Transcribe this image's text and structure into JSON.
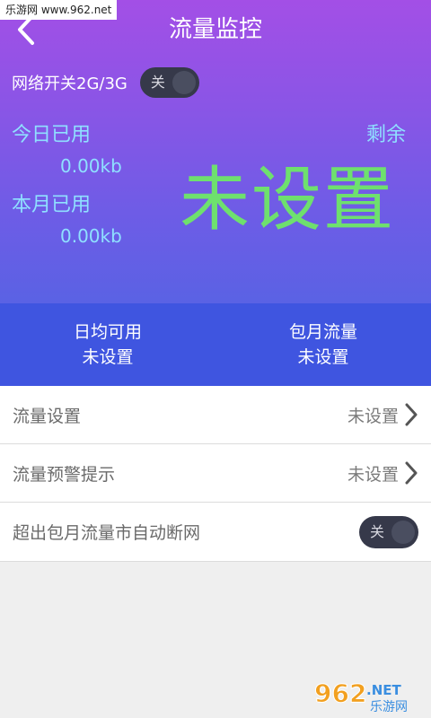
{
  "watermark_top": "乐游网 www.962.net",
  "header": {
    "title": "流量监控"
  },
  "network": {
    "label": "网络开关2G/3G",
    "toggle_text": "关"
  },
  "stats": {
    "today_label": "今日已用",
    "today_value": "0.00kb",
    "month_label": "本月已用",
    "month_value": "0.00kb",
    "remain_label": "剩余",
    "remain_value": "未设置"
  },
  "summary": {
    "daily_label": "日均可用",
    "daily_value": "未设置",
    "package_label": "包月流量",
    "package_value": "未设置"
  },
  "settings": [
    {
      "label": "流量设置",
      "value": "未设置"
    },
    {
      "label": "流量预警提示",
      "value": "未设置"
    }
  ],
  "auto_cut": {
    "label": "超出包月流量市自动断网",
    "toggle_text": "关"
  },
  "watermark_bottom": {
    "main": "962",
    "suffix": ".NET",
    "sub": "乐游网"
  },
  "colors": {
    "accent_green": "#6ee06e",
    "stat_text": "#8fe0ff",
    "stripe": "#3f55e0"
  }
}
